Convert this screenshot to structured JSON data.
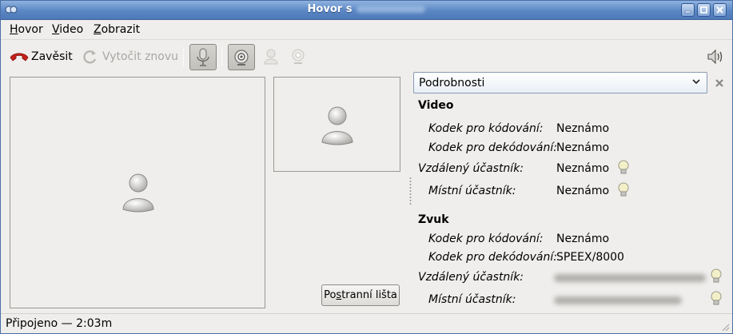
{
  "window": {
    "title": "Hovor s"
  },
  "menu": [
    {
      "label": "Hovor",
      "mnemonic": "H",
      "rest": "ovor"
    },
    {
      "label": "Video",
      "mnemonic": "V",
      "rest": "ideo"
    },
    {
      "label": "Zobrazit",
      "mnemonic": "Z",
      "rest": "obrazit"
    }
  ],
  "toolbar": {
    "hangup_label": "Zavěsit",
    "redial_label": "Vytočit znovu"
  },
  "sidebar_button": {
    "prefix": "Po",
    "mnemonic": "s",
    "suffix": "tranní lišta"
  },
  "details": {
    "dropdown_value": "Podrobnosti",
    "video": {
      "heading": "Video",
      "rows": [
        {
          "label": "Kodek pro kódování:",
          "value": "Neznámo"
        },
        {
          "label": "Kodek pro dekódování:",
          "value": "Neznámo"
        },
        {
          "label": "Vzdálený účastník:",
          "value": "Neznámo"
        },
        {
          "label": "Místní účastník:",
          "value": "Neznámo"
        }
      ]
    },
    "audio": {
      "heading": "Zvuk",
      "rows": [
        {
          "label": "Kodek pro kódování:",
          "value": "Neznámo"
        },
        {
          "label": "Kodek pro dekódování:",
          "value": "SPEEX/8000"
        },
        {
          "label": "Vzdálený účastník:",
          "value": ""
        },
        {
          "label": "Místní účastník:",
          "value": ""
        }
      ]
    }
  },
  "status": {
    "text": "Připojeno — 2:03m"
  },
  "icons": {
    "hangup": "phone-hangup-icon",
    "redial": "redial-icon",
    "microphone": "microphone-icon",
    "camera_on": "webcam-icon",
    "send_video": "user-video-icon",
    "camera_off": "webcam-off-icon",
    "volume": "speaker-icon"
  },
  "colors": {
    "titlebar": "#5a86c4",
    "hangup_red": "#c8201a"
  }
}
